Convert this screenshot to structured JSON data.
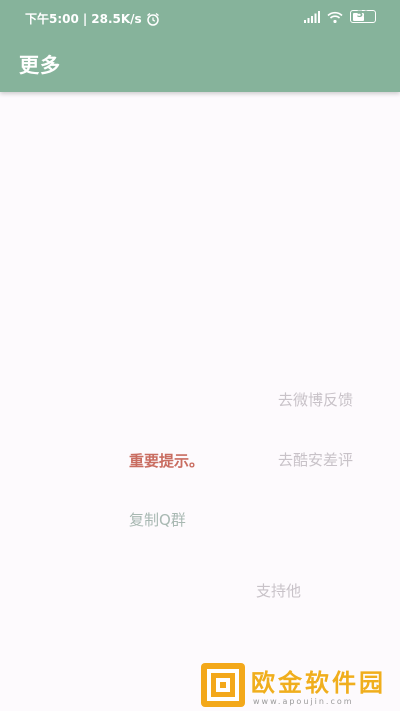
{
  "status_bar": {
    "time": "下午5:00",
    "separator": "|",
    "net_speed": "28.5K/s",
    "battery": "59",
    "battery_level": 0.59,
    "icons": [
      "alarm-icon",
      "signal-icon",
      "wifi-icon",
      "battery-icon"
    ]
  },
  "app_bar": {
    "title": "更多"
  },
  "floating_labels": {
    "weibo_feedback": "去微博反馈",
    "coolapk_review": "去酷安差评",
    "important_notice": "重要提示。",
    "copy_qq_group": "复制Q群",
    "support_him": "支持他"
  },
  "watermark": {
    "name": "欧金软件园",
    "url": "www.apoujin.com"
  },
  "colors": {
    "accent": "#86b39b",
    "notice": "#c96d61",
    "muted": "#c8c2c8",
    "qq": "#a8b8b2",
    "watermark": "#f0ae1d"
  }
}
